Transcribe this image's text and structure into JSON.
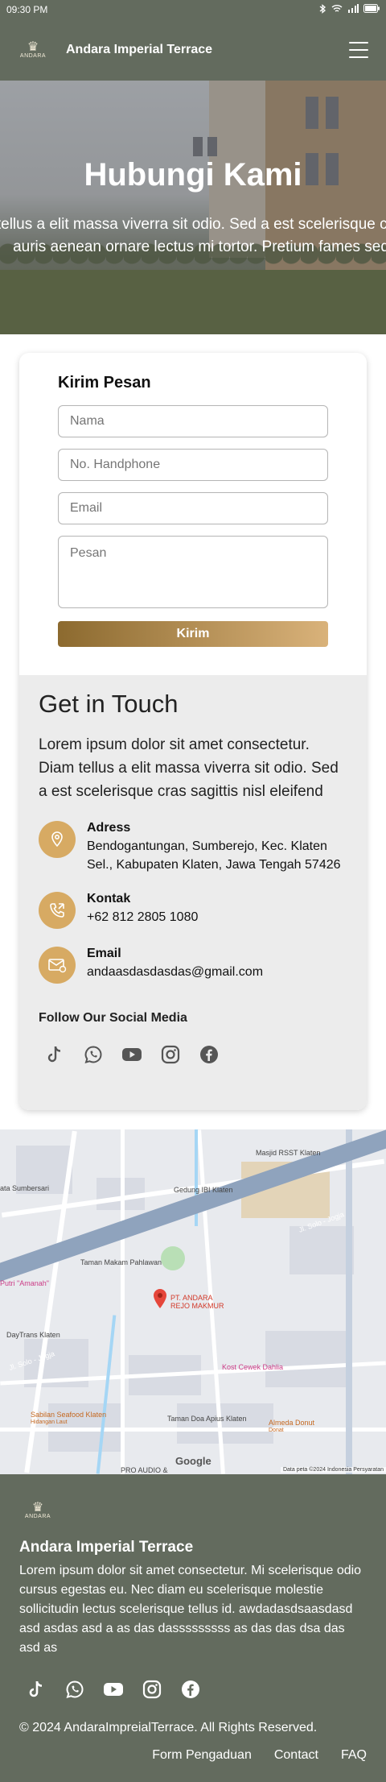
{
  "status_bar": {
    "time": "09:30 PM"
  },
  "header": {
    "logo_text": "ANDARA",
    "title": "Andara Imperial Terrace",
    "menu_icon": "hamburger-menu-icon"
  },
  "hero": {
    "title": "Hubungi Kami",
    "line1": "n tellus a elit massa viverra sit odio. Sed a est scelerisque cras sagittis",
    "line2": "auris aenean ornare lectus mi tortor. Pretium fames sed"
  },
  "form": {
    "title": "Kirim Pesan",
    "name_placeholder": "Nama",
    "phone_placeholder": "No. Handphone",
    "email_placeholder": "Email",
    "message_placeholder": "Pesan",
    "submit_label": "Kirim"
  },
  "get_in_touch": {
    "title": "Get in Touch",
    "description": "Lorem ipsum dolor sit amet consectetur. Diam tellus a elit massa viverra sit odio. Sed a est scelerisque cras sagittis nisl eleifend",
    "address_label": "Adress",
    "address_value": "Bendogantungan, Sumberejo, Kec. Klaten Sel., Kabupaten Klaten, Jawa Tengah 57426",
    "contact_label": "Kontak",
    "contact_value": "+62 812 2805 1080",
    "email_label": "Email",
    "email_value": "andaasdasdasdas@gmail.com",
    "follow_label": "Follow Our Social Media"
  },
  "map": {
    "labels": {
      "masjid": "Masjid RSST Klaten",
      "sumbersari": "ata Sumbersari",
      "gedung": "Gedung IBI Klaten",
      "taman_makam": "Taman Makam Pahlawan",
      "putri": "Putri \"Amanah\"",
      "pin_line1": "PT. ANDARA",
      "pin_line2": "REJO MAKMUR",
      "daytrans": "DayTrans Klaten",
      "kost": "Kost Cewek Dahlia",
      "sabilan": "Sabilan Seafood Klaten",
      "sabilan_sub": "Hidangan Laut",
      "taman_doa": "Taman Doa Apius Klaten",
      "almeda": "Almeda Donut",
      "almeda_sub": "Donat",
      "pro_audio": "PRO AUDIO &",
      "jl_solo": "Jl. Solo - Jogja",
      "jl_solo_right": "Jl. Solo - Jogja"
    },
    "google": "Google",
    "attribution": "Data peta ©2024   Indonesia   Persyaratan"
  },
  "footer": {
    "logo_text": "ANDARA",
    "title": "Andara Imperial Terrace",
    "description": "Lorem ipsum dolor sit amet consectetur. Mi scelerisque odio cursus egestas eu. Nec diam eu scelerisque molestie sollicitudin lectus scelerisque tellus id. awdadasdsaasdasd asd asdas asd a as das dasssssssss as das das dsa das asd as",
    "copyright": "© 2024 AndaraImpreialTerrace. All Rights Reserved.",
    "links": [
      "Form Pengaduan",
      "Contact",
      "FAQ"
    ]
  },
  "colors": {
    "header": "#636b5e",
    "accent_gold": "#d7aa63",
    "button_start": "#8c6a2f",
    "button_end": "#d9b27a"
  }
}
